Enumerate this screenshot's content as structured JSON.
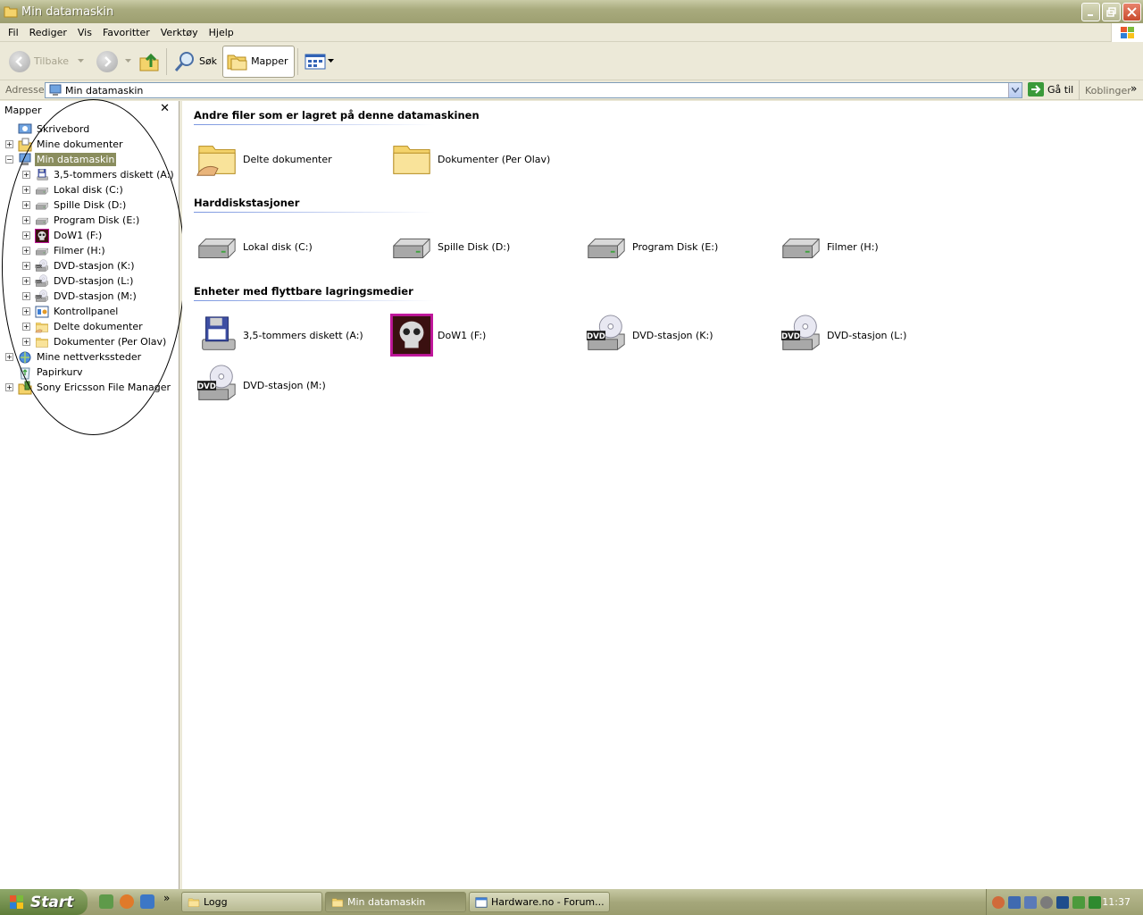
{
  "window": {
    "title": "Min datamaskin"
  },
  "menu": {
    "items": [
      "Fil",
      "Rediger",
      "Vis",
      "Favoritter",
      "Verktøy",
      "Hjelp"
    ]
  },
  "toolbar": {
    "back": "Tilbake",
    "search": "Søk",
    "folders": "Mapper"
  },
  "address": {
    "label": "Adresse",
    "value": "Min datamaskin",
    "go": "Gå til",
    "links": "Koblinger"
  },
  "folderpane": {
    "title": "Mapper",
    "tree": [
      {
        "label": "Skrivebord",
        "icon": "desktop-icon",
        "expander": ""
      },
      {
        "label": "Mine dokumenter",
        "icon": "my-documents-icon",
        "expander": "+"
      },
      {
        "label": "Min datamaskin",
        "icon": "computer-icon",
        "expander": "−",
        "selected": true
      },
      {
        "label": "3,5-tommers diskett (A:)",
        "icon": "floppy-icon",
        "expander": "+"
      },
      {
        "label": "Lokal disk (C:)",
        "icon": "hard-disk-icon",
        "expander": "+"
      },
      {
        "label": "Spille Disk (D:)",
        "icon": "hard-disk-icon",
        "expander": "+"
      },
      {
        "label": "Program Disk (E:)",
        "icon": "hard-disk-icon",
        "expander": "+"
      },
      {
        "label": "DoW1 (F:)",
        "icon": "skull-icon",
        "expander": "+"
      },
      {
        "label": "Filmer (H:)",
        "icon": "hard-disk-icon",
        "expander": "+"
      },
      {
        "label": "DVD-stasjon (K:)",
        "icon": "dvd-drive-icon",
        "expander": "+"
      },
      {
        "label": "DVD-stasjon (L:)",
        "icon": "dvd-drive-icon",
        "expander": "+"
      },
      {
        "label": "DVD-stasjon (M:)",
        "icon": "dvd-drive-icon",
        "expander": "+"
      },
      {
        "label": "Kontrollpanel",
        "icon": "control-panel-icon",
        "expander": "+"
      },
      {
        "label": "Delte dokumenter",
        "icon": "shared-folder-icon",
        "expander": "+"
      },
      {
        "label": "Dokumenter (Per Olav)",
        "icon": "folder-icon",
        "expander": "+"
      },
      {
        "label": "Mine nettverkssteder",
        "icon": "network-places-icon",
        "expander": "+"
      },
      {
        "label": "Papirkurv",
        "icon": "recycle-bin-icon",
        "expander": ""
      },
      {
        "label": "Sony Ericsson File Manager",
        "icon": "phone-manager-icon",
        "expander": "+"
      }
    ]
  },
  "content": {
    "groups": [
      {
        "title": "Andre filer som er lagret på denne datamaskinen",
        "items": [
          {
            "label": "Delte dokumenter",
            "icon": "shared-folder-icon"
          },
          {
            "label": "Dokumenter (Per Olav)",
            "icon": "folder-icon"
          }
        ]
      },
      {
        "title": "Harddiskstasjoner",
        "items": [
          {
            "label": "Lokal disk (C:)",
            "icon": "hard-disk-icon"
          },
          {
            "label": "Spille Disk (D:)",
            "icon": "hard-disk-icon"
          },
          {
            "label": "Program Disk (E:)",
            "icon": "hard-disk-icon"
          },
          {
            "label": "Filmer (H:)",
            "icon": "hard-disk-icon"
          }
        ]
      },
      {
        "title": "Enheter med flyttbare lagringsmedier",
        "items": [
          {
            "label": "3,5-tommers diskett (A:)",
            "icon": "floppy-icon"
          },
          {
            "label": "DoW1 (F:)",
            "icon": "skull-icon"
          },
          {
            "label": "DVD-stasjon (K:)",
            "icon": "dvd-drive-icon"
          },
          {
            "label": "DVD-stasjon (L:)",
            "icon": "dvd-drive-icon"
          },
          {
            "label": "DVD-stasjon (M:)",
            "icon": "dvd-drive-icon"
          }
        ]
      }
    ],
    "dvd_badge": "DVD"
  },
  "taskbar": {
    "start": "Start",
    "tasks": [
      {
        "label": "Logg",
        "icon": "folder-icon",
        "active": false
      },
      {
        "label": "Min datamaskin",
        "icon": "folder-icon",
        "active": true
      },
      {
        "label": "Hardware.no - Forum...",
        "icon": "browser-icon",
        "active": false
      }
    ],
    "clock": "11:37"
  }
}
